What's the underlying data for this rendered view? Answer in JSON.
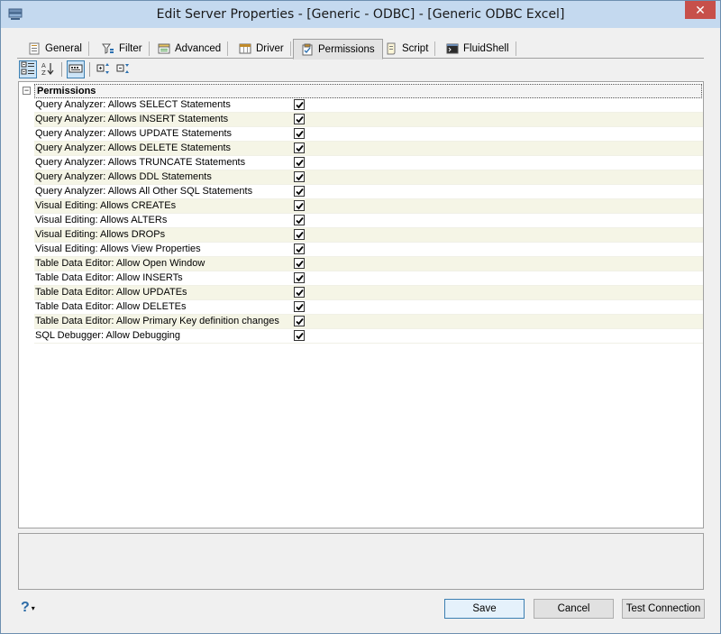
{
  "window": {
    "title": "Edit Server Properties - [Generic - ODBC] - [Generic ODBC Excel]",
    "close_label": "✕"
  },
  "tabs": [
    {
      "label": "General",
      "icon": "general-icon"
    },
    {
      "label": "Filter",
      "icon": "filter-icon"
    },
    {
      "label": "Advanced",
      "icon": "advanced-icon"
    },
    {
      "label": "Driver",
      "icon": "driver-icon"
    },
    {
      "label": "Permissions",
      "icon": "permissions-icon",
      "active": true
    },
    {
      "label": "Script",
      "icon": "script-icon"
    },
    {
      "label": "FluidShell",
      "icon": "fluidshell-icon"
    }
  ],
  "toolbar": {
    "buttons": [
      "categorized-icon",
      "alphabetical-icon",
      "property-pages-icon",
      "expand-all-icon",
      "collapse-all-icon"
    ]
  },
  "grid": {
    "category": "Permissions",
    "toggle": "−",
    "rows": [
      {
        "label": "Query Analyzer: Allows SELECT Statements",
        "checked": true
      },
      {
        "label": "Query Analyzer: Allows INSERT Statements",
        "checked": true
      },
      {
        "label": "Query Analyzer: Allows UPDATE Statements",
        "checked": true
      },
      {
        "label": "Query Analyzer: Allows DELETE Statements",
        "checked": true
      },
      {
        "label": "Query Analyzer: Allows TRUNCATE Statements",
        "checked": true
      },
      {
        "label": "Query Analyzer: Allows DDL Statements",
        "checked": true
      },
      {
        "label": "Query Analyzer: Allows All Other SQL Statements",
        "checked": true
      },
      {
        "label": "Visual Editing: Allows CREATEs",
        "checked": true
      },
      {
        "label": "Visual Editing: Allows ALTERs",
        "checked": true
      },
      {
        "label": "Visual Editing: Allows DROPs",
        "checked": true
      },
      {
        "label": "Visual Editing: Allows View Properties",
        "checked": true
      },
      {
        "label": "Table Data Editor: Allow Open Window",
        "checked": true
      },
      {
        "label": "Table Data Editor: Allow INSERTs",
        "checked": true
      },
      {
        "label": "Table Data Editor: Allow UPDATEs",
        "checked": true
      },
      {
        "label": "Table Data Editor: Allow DELETEs",
        "checked": true
      },
      {
        "label": "Table Data Editor: Allow Primary Key definition changes",
        "checked": true
      },
      {
        "label": "SQL Debugger: Allow Debugging",
        "checked": true
      }
    ]
  },
  "footer": {
    "help_label": "?",
    "help_caret": "▾",
    "save_label": "Save",
    "cancel_label": "Cancel",
    "test_label": "Test Connection"
  },
  "colors": {
    "titlebar": "#c4d9ef",
    "close": "#c7504a",
    "alt_row": "#f5f5e6",
    "default_button_border": "#3c7fb1"
  }
}
